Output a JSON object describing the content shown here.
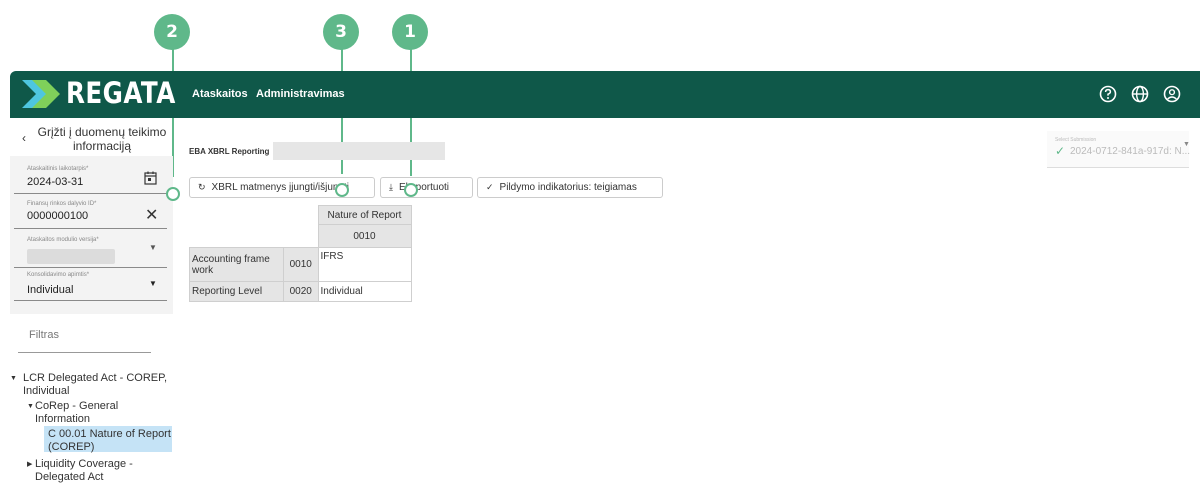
{
  "markers": [
    "1",
    "2",
    "3"
  ],
  "header": {
    "logo_text": "REGATA",
    "nav": [
      "Ataskaitos",
      "Administravimas"
    ],
    "icons": [
      "help-icon",
      "globe-icon",
      "user-icon"
    ]
  },
  "sidebar": {
    "back_label": "Grįžti į duomenų teikimo informaciją",
    "fields": [
      {
        "label": "Ataskaitinis laikotarpis*",
        "value": "2024-03-31",
        "icon": "calendar-icon"
      },
      {
        "label": "Finansų rinkos dalyvio ID*",
        "value": "0000000100",
        "icon": "close-icon"
      },
      {
        "label": "Ataskaitos modulio versija*",
        "value": "",
        "icon": "chevron-down-icon"
      },
      {
        "label": "Konsolidavimo apimtis*",
        "value": "Individual",
        "icon": "chevron-down-icon"
      }
    ],
    "filter_placeholder": "Filtras",
    "tree": {
      "root": "LCR Delegated Act - COREP, Individual",
      "child": "CoRep - General Information",
      "selected": "C 00.01 Nature of Report (COREP)",
      "sibling": "Liquidity Coverage - Delegated Act"
    }
  },
  "main": {
    "title": "EBA XBRL Reporting",
    "buttons": [
      {
        "label": "XBRL matmenys įjungti/išjungti",
        "icon": "refresh-icon"
      },
      {
        "label": "Eksportuoti",
        "icon": "download-icon"
      },
      {
        "label": "Pildymo indikatorius: teigiamas",
        "icon": "check-icon"
      }
    ],
    "submission": {
      "label": "Select Submission",
      "value": "2024-0712-841a-917d: N..."
    },
    "table": {
      "column_header": "Nature of Report",
      "column_code": "0010",
      "rows": [
        {
          "label": "Accounting frame work",
          "code": "0010",
          "value": "IFRS"
        },
        {
          "label": "Reporting Level",
          "code": "0020",
          "value": "Individual"
        }
      ]
    }
  },
  "colors": {
    "header": "#0f5849",
    "marker": "#5fb88a",
    "selected": "#c5e3f6"
  }
}
